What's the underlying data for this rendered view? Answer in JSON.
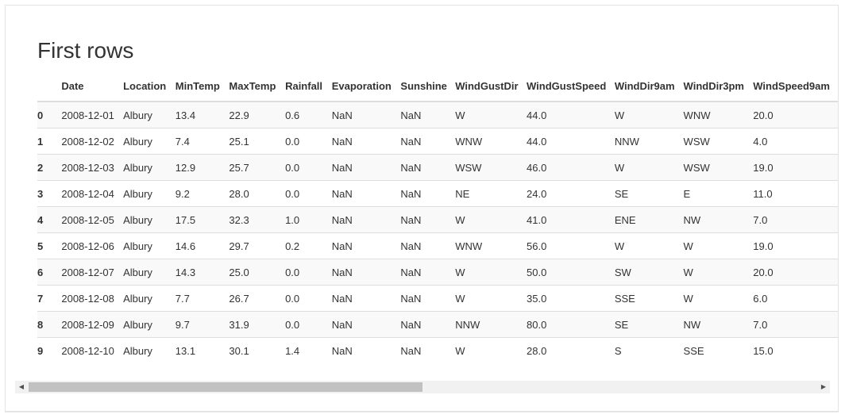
{
  "title": "First rows",
  "columns": [
    "",
    "Date",
    "Location",
    "MinTemp",
    "MaxTemp",
    "Rainfall",
    "Evaporation",
    "Sunshine",
    "WindGustDir",
    "WindGustSpeed",
    "WindDir9am",
    "WindDir3pm",
    "WindSpeed9am"
  ],
  "rows": [
    [
      "0",
      "2008-12-01",
      "Albury",
      "13.4",
      "22.9",
      "0.6",
      "NaN",
      "NaN",
      "W",
      "44.0",
      "W",
      "WNW",
      "20.0"
    ],
    [
      "1",
      "2008-12-02",
      "Albury",
      "7.4",
      "25.1",
      "0.0",
      "NaN",
      "NaN",
      "WNW",
      "44.0",
      "NNW",
      "WSW",
      "4.0"
    ],
    [
      "2",
      "2008-12-03",
      "Albury",
      "12.9",
      "25.7",
      "0.0",
      "NaN",
      "NaN",
      "WSW",
      "46.0",
      "W",
      "WSW",
      "19.0"
    ],
    [
      "3",
      "2008-12-04",
      "Albury",
      "9.2",
      "28.0",
      "0.0",
      "NaN",
      "NaN",
      "NE",
      "24.0",
      "SE",
      "E",
      "11.0"
    ],
    [
      "4",
      "2008-12-05",
      "Albury",
      "17.5",
      "32.3",
      "1.0",
      "NaN",
      "NaN",
      "W",
      "41.0",
      "ENE",
      "NW",
      "7.0"
    ],
    [
      "5",
      "2008-12-06",
      "Albury",
      "14.6",
      "29.7",
      "0.2",
      "NaN",
      "NaN",
      "WNW",
      "56.0",
      "W",
      "W",
      "19.0"
    ],
    [
      "6",
      "2008-12-07",
      "Albury",
      "14.3",
      "25.0",
      "0.0",
      "NaN",
      "NaN",
      "W",
      "50.0",
      "SW",
      "W",
      "20.0"
    ],
    [
      "7",
      "2008-12-08",
      "Albury",
      "7.7",
      "26.7",
      "0.0",
      "NaN",
      "NaN",
      "W",
      "35.0",
      "SSE",
      "W",
      "6.0"
    ],
    [
      "8",
      "2008-12-09",
      "Albury",
      "9.7",
      "31.9",
      "0.0",
      "NaN",
      "NaN",
      "NNW",
      "80.0",
      "SE",
      "NW",
      "7.0"
    ],
    [
      "9",
      "2008-12-10",
      "Albury",
      "13.1",
      "30.1",
      "1.4",
      "NaN",
      "NaN",
      "W",
      "28.0",
      "S",
      "SSE",
      "15.0"
    ]
  ],
  "scrollbar": {
    "left_arrow_icon": "triangle-left",
    "right_arrow_icon": "triangle-right",
    "position_fraction": 0.0,
    "visible_fraction": 0.5
  }
}
